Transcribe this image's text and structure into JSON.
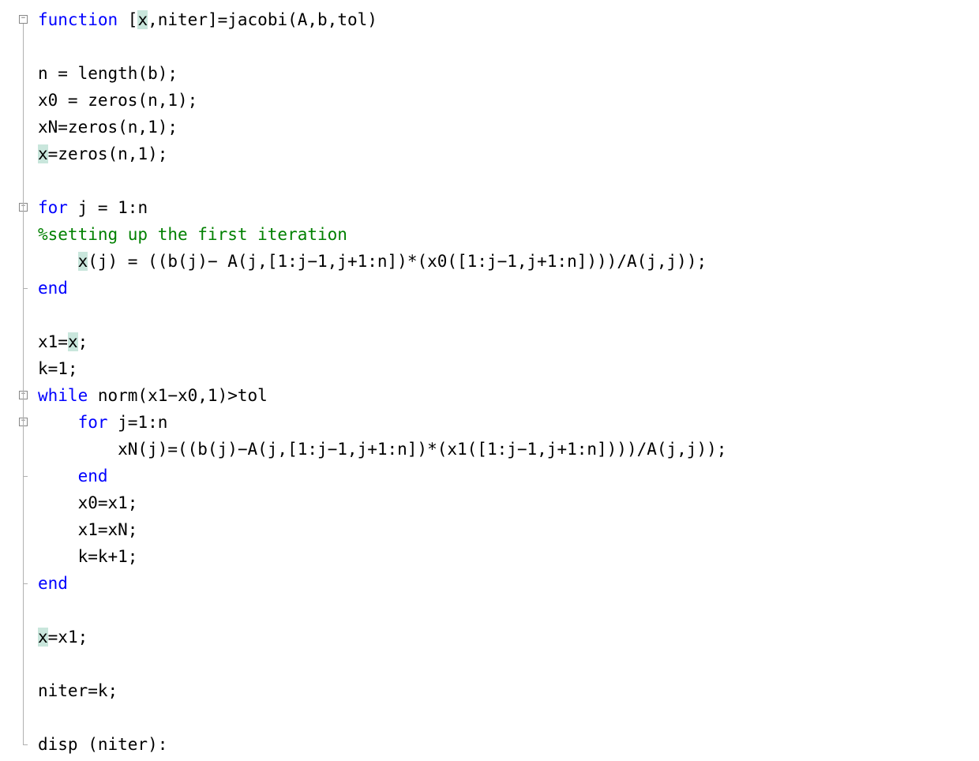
{
  "code": {
    "colors": {
      "keyword": "#0000ff",
      "comment": "#008000",
      "text": "#000000",
      "highlight_bg": "#c9e6dc",
      "fold_border": "#888888",
      "fold_line": "#b0b0b0",
      "background": "#ffffff"
    },
    "highlighted_variable": "x",
    "lines": [
      {
        "n": 1,
        "fold": "open",
        "segments": [
          {
            "t": "function",
            "c": "kw"
          },
          {
            "t": " [",
            "c": "txt"
          },
          {
            "t": "x",
            "c": "hl"
          },
          {
            "t": ",niter]=jacobi(A,b,tol)",
            "c": "txt"
          }
        ]
      },
      {
        "n": 2,
        "segments": []
      },
      {
        "n": 3,
        "segments": [
          {
            "t": "n = length(b);",
            "c": "txt"
          }
        ]
      },
      {
        "n": 4,
        "segments": [
          {
            "t": "x0 = zeros(n,1);",
            "c": "txt"
          }
        ]
      },
      {
        "n": 5,
        "segments": [
          {
            "t": "xN=zeros(n,1);",
            "c": "txt"
          }
        ]
      },
      {
        "n": 6,
        "segments": [
          {
            "t": "x",
            "c": "hl"
          },
          {
            "t": "=zeros(n,1);",
            "c": "txt"
          }
        ]
      },
      {
        "n": 7,
        "segments": []
      },
      {
        "n": 8,
        "fold": "open",
        "segments": [
          {
            "t": "for",
            "c": "kw"
          },
          {
            "t": " j = 1:n",
            "c": "txt"
          }
        ]
      },
      {
        "n": 9,
        "segments": [
          {
            "t": "%setting up the first iteration",
            "c": "cm"
          }
        ]
      },
      {
        "n": 10,
        "segments": [
          {
            "t": "    ",
            "c": "txt"
          },
          {
            "t": "x",
            "c": "hl"
          },
          {
            "t": "(j) = ((b(j)− A(j,[1:j−1,j+1:n])*(x0([1:j−1,j+1:n])))/A(j,j));",
            "c": "txt"
          }
        ]
      },
      {
        "n": 11,
        "fold": "end",
        "segments": [
          {
            "t": "end",
            "c": "kw"
          }
        ]
      },
      {
        "n": 12,
        "segments": []
      },
      {
        "n": 13,
        "segments": [
          {
            "t": "x1=",
            "c": "txt"
          },
          {
            "t": "x",
            "c": "hl"
          },
          {
            "t": ";",
            "c": "txt"
          }
        ]
      },
      {
        "n": 14,
        "segments": [
          {
            "t": "k=1;",
            "c": "txt"
          }
        ]
      },
      {
        "n": 15,
        "fold": "open",
        "segments": [
          {
            "t": "while",
            "c": "kw"
          },
          {
            "t": " norm(x1−x0,1)>tol",
            "c": "txt"
          }
        ]
      },
      {
        "n": 16,
        "fold": "open",
        "segments": [
          {
            "t": "    ",
            "c": "txt"
          },
          {
            "t": "for",
            "c": "kw"
          },
          {
            "t": " j=1:n",
            "c": "txt"
          }
        ]
      },
      {
        "n": 17,
        "segments": [
          {
            "t": "        xN(j)=((b(j)−A(j,[1:j−1,j+1:n])*(x1([1:j−1,j+1:n])))/A(j,j));",
            "c": "txt"
          }
        ]
      },
      {
        "n": 18,
        "fold": "end",
        "segments": [
          {
            "t": "    ",
            "c": "txt"
          },
          {
            "t": "end",
            "c": "kw"
          }
        ]
      },
      {
        "n": 19,
        "segments": [
          {
            "t": "    x0=x1;",
            "c": "txt"
          }
        ]
      },
      {
        "n": 20,
        "segments": [
          {
            "t": "    x1=xN;",
            "c": "txt"
          }
        ]
      },
      {
        "n": 21,
        "segments": [
          {
            "t": "    k=k+1;",
            "c": "txt"
          }
        ]
      },
      {
        "n": 22,
        "fold": "end",
        "segments": [
          {
            "t": "end",
            "c": "kw"
          }
        ]
      },
      {
        "n": 23,
        "segments": []
      },
      {
        "n": 24,
        "segments": [
          {
            "t": "x",
            "c": "hl"
          },
          {
            "t": "=x1;",
            "c": "txt"
          }
        ]
      },
      {
        "n": 25,
        "segments": []
      },
      {
        "n": 26,
        "segments": [
          {
            "t": "niter=k;",
            "c": "txt"
          }
        ]
      },
      {
        "n": 27,
        "segments": []
      },
      {
        "n": 28,
        "fold": "end",
        "segments": [
          {
            "t": "disp (niter):",
            "c": "txt"
          }
        ]
      }
    ],
    "fold_regions": [
      {
        "start": 1,
        "end": 28
      },
      {
        "start": 8,
        "end": 11
      },
      {
        "start": 15,
        "end": 22
      },
      {
        "start": 16,
        "end": 18
      }
    ]
  }
}
